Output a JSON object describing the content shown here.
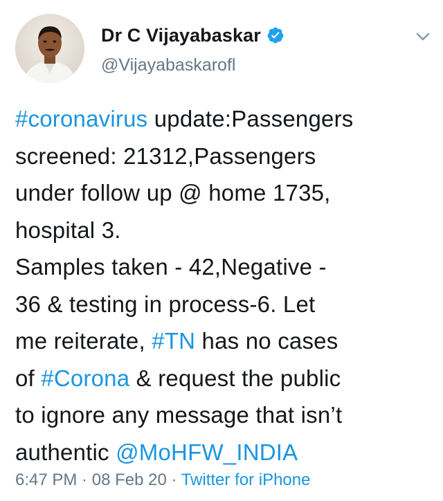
{
  "author": {
    "display_name": "Dr C Vijayabaskar",
    "handle": "@Vijayabaskarofl",
    "verified": true,
    "avatar_icon": "profile-photo",
    "verified_icon": "verified-badge-icon"
  },
  "tweet": {
    "lines": [
      [
        {
          "text": "#coronavirus",
          "link": true
        },
        {
          "text": " update:Passengers",
          "link": false
        }
      ],
      [
        {
          "text": "screened: 21312,Passengers",
          "link": false
        }
      ],
      [
        {
          "text": "under follow up @ home 1735,",
          "link": false
        }
      ],
      [
        {
          "text": "hospital 3.",
          "link": false
        }
      ],
      [
        {
          "text": "Samples taken - 42,Negative -",
          "link": false
        }
      ],
      [
        {
          "text": "36 & testing in process-6. Let",
          "link": false
        }
      ],
      [
        {
          "text": "me reiterate, ",
          "link": false
        },
        {
          "text": "#TN",
          "link": true
        },
        {
          "text": " has no cases",
          "link": false
        }
      ],
      [
        {
          "text": "of ",
          "link": false
        },
        {
          "text": "#Corona",
          "link": true
        },
        {
          "text": " & request the public",
          "link": false
        }
      ],
      [
        {
          "text": "to ignore any message that isn’t",
          "link": false
        }
      ],
      [
        {
          "text": "authentic ",
          "link": false
        },
        {
          "text": "@MoHFW_INDIA",
          "link": true
        }
      ]
    ]
  },
  "meta": {
    "time": "6:47 PM",
    "separator": " · ",
    "date": "08 Feb 20",
    "source": "Twitter for iPhone"
  },
  "colors": {
    "link": "#1b95e0",
    "text": "#14171a",
    "muted": "#657786",
    "verified": "#1da1f2"
  }
}
